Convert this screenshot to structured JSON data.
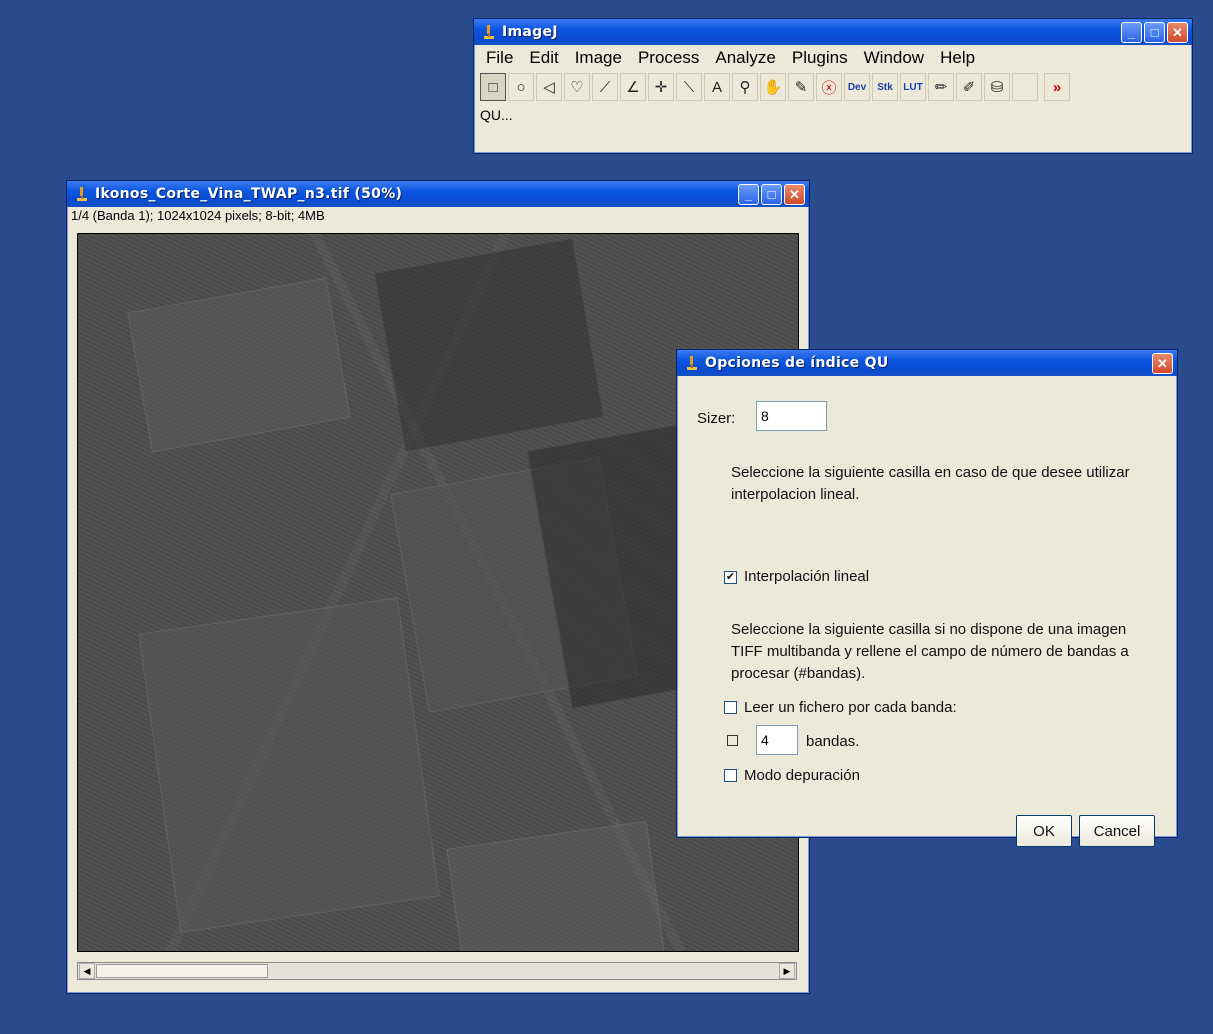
{
  "imagej": {
    "title": "ImageJ",
    "menu": [
      "File",
      "Edit",
      "Image",
      "Process",
      "Analyze",
      "Plugins",
      "Window",
      "Help"
    ],
    "tools": [
      {
        "name": "rectangle-tool-icon",
        "glyph": "□"
      },
      {
        "name": "oval-tool-icon",
        "glyph": "○"
      },
      {
        "name": "polygon-tool-icon",
        "glyph": "◁"
      },
      {
        "name": "freehand-tool-icon",
        "glyph": "♡"
      },
      {
        "name": "line-tool-icon",
        "glyph": "⟋"
      },
      {
        "name": "angle-tool-icon",
        "glyph": "∠"
      },
      {
        "name": "point-tool-icon",
        "glyph": "✛"
      },
      {
        "name": "wand-tool-icon",
        "glyph": "⟍"
      },
      {
        "name": "text-tool-icon",
        "glyph": "A"
      },
      {
        "name": "magnifier-tool-icon",
        "glyph": "⚲"
      },
      {
        "name": "hand-tool-icon",
        "glyph": "✋"
      },
      {
        "name": "dropper-tool-icon",
        "glyph": "✎"
      },
      {
        "name": "stop-tool-icon",
        "glyph": "ⓧ"
      },
      {
        "name": "dev-tool-icon",
        "glyph": "Dev"
      },
      {
        "name": "stk-tool-icon",
        "glyph": "Stk"
      },
      {
        "name": "lut-tool-icon",
        "glyph": "LUT"
      },
      {
        "name": "pencil-tool-icon",
        "glyph": "✏"
      },
      {
        "name": "brush-tool-icon",
        "glyph": "✐"
      },
      {
        "name": "flood-fill-tool-icon",
        "glyph": "⛁"
      },
      {
        "name": "blank-tool-icon",
        "glyph": ""
      },
      {
        "name": "more-tools-icon",
        "glyph": "»"
      }
    ],
    "status": "QU..."
  },
  "image_window": {
    "title": "Ikonos_Corte_Vina_TWAP_n3.tif (50%)",
    "info": "1/4 (Banda 1); 1024x1024 pixels; 8-bit; 4MB"
  },
  "dialog": {
    "title": "Opciones de índice QU",
    "sizer_label": "Sizer:",
    "sizer_value": "8",
    "text1": "Seleccione la siguiente casilla en caso de que desee utilizar interpolacion lineal.",
    "interp_label": "Interpolación lineal",
    "interp_checked": true,
    "text2": "Seleccione la siguiente casilla si no dispone de una imagen TIFF multibanda y rellene el campo de número de bandas a procesar (#bandas).",
    "leer_label": "Leer un fichero por cada banda:",
    "bandas_value": "4",
    "bandas_label": "bandas.",
    "modo_label": "Modo depuración",
    "ok_label": "OK",
    "cancel_label": "Cancel"
  }
}
